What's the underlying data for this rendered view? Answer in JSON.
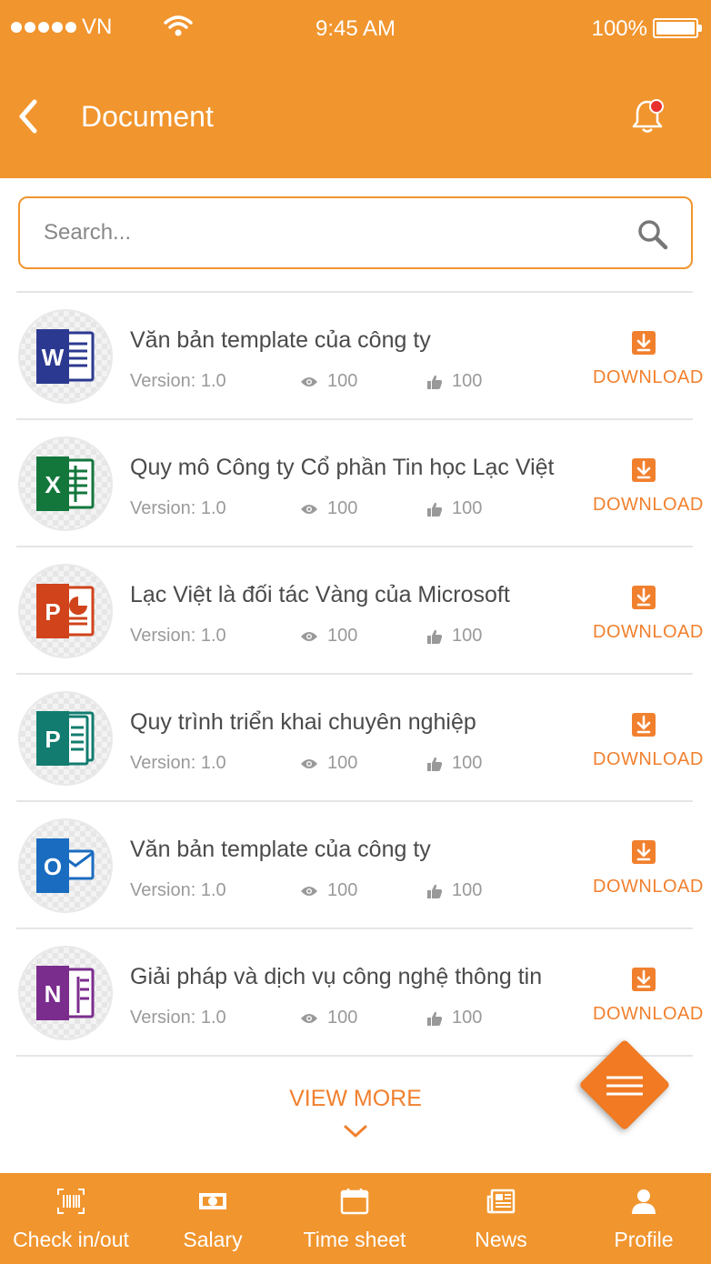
{
  "status_bar": {
    "carrier": "VN",
    "time": "9:45 AM",
    "battery": "100%"
  },
  "header": {
    "title": "Document"
  },
  "search": {
    "placeholder": "Search..."
  },
  "documents": [
    {
      "app": "word",
      "letter": "W",
      "color": "#2B3990",
      "title": "Văn bản template của công ty",
      "version": "Version: 1.0",
      "views": "100",
      "likes": "100",
      "download": "DOWNLOAD"
    },
    {
      "app": "excel",
      "letter": "X",
      "color": "#13773C",
      "title": "Quy mô Công ty Cổ phần Tin học Lạc Việt",
      "version": "Version: 1.0",
      "views": "100",
      "likes": "100",
      "download": "DOWNLOAD"
    },
    {
      "app": "powerpoint",
      "letter": "P",
      "color": "#D0431B",
      "title": "Lạc Việt là đối tác Vàng của Microsoft",
      "version": "Version: 1.0",
      "views": "100",
      "likes": "100",
      "download": "DOWNLOAD"
    },
    {
      "app": "publisher",
      "letter": "P",
      "color": "#117C6F",
      "title": "Quy trình triển khai chuyên nghiệp",
      "version": "Version: 1.0",
      "views": "100",
      "likes": "100",
      "download": "DOWNLOAD"
    },
    {
      "app": "outlook",
      "letter": "O",
      "color": "#1A6CC0",
      "title": "Văn bản template của công ty",
      "version": "Version: 1.0",
      "views": "100",
      "likes": "100",
      "download": "DOWNLOAD"
    },
    {
      "app": "onenote",
      "letter": "N",
      "color": "#7B2D8E",
      "title": "Giải pháp và dịch vụ công nghệ thông tin",
      "version": "Version: 1.0",
      "views": "100",
      "likes": "100",
      "download": "DOWNLOAD"
    }
  ],
  "view_more": "VIEW MORE",
  "tabs": [
    {
      "label": "Check in/out",
      "icon": "barcode-icon"
    },
    {
      "label": "Salary",
      "icon": "money-icon"
    },
    {
      "label": "Time sheet",
      "icon": "calendar-icon"
    },
    {
      "label": "News",
      "icon": "newspaper-icon"
    },
    {
      "label": "Profile",
      "icon": "person-icon"
    }
  ],
  "colors": {
    "primary": "#F1952E",
    "accent": "#F1802E",
    "notification_dot": "#E8312F"
  }
}
